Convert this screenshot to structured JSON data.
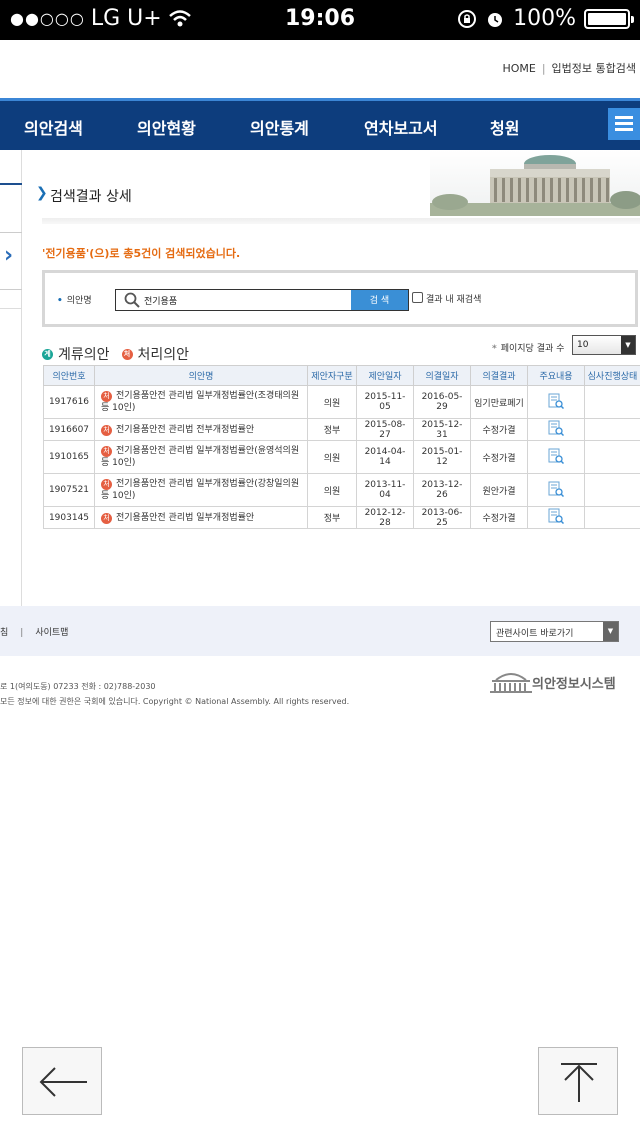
{
  "status": {
    "signal": "●●○○○",
    "carrier": "LG U+",
    "time": "19:06",
    "battery": "100%"
  },
  "toplinks": {
    "home": "HOME",
    "sep": "|",
    "integrated": "입법정보 통합검색"
  },
  "nav": {
    "items": [
      "의안검색",
      "의안현황",
      "의안통계",
      "연차보고서",
      "청원"
    ]
  },
  "breadcrumb": {
    "title": "검색결과 상세"
  },
  "result_message": "'전기용품'(으)로 총5건이 검색되었습니다.",
  "search": {
    "label": "의안명",
    "value": "전기용품",
    "button": "검 색",
    "within_label": "결과 내 재검색"
  },
  "legend": {
    "pending_badge": "계",
    "pending": "계류의안",
    "processed_badge": "처",
    "processed": "처리의안"
  },
  "perpage": {
    "label": "페이지당 결과 수",
    "value": "10"
  },
  "table": {
    "headers": [
      "의안번호",
      "의안명",
      "제안자구분",
      "제안일자",
      "의결일자",
      "의결결과",
      "주요내용",
      "심사진행상태"
    ],
    "rows": [
      {
        "no": "1917616",
        "badge": "처",
        "name": "전기용품안전 관리법 일부개정법률안(조경태의원 등 10인)",
        "proposer": "의원",
        "proposed": "2015-11-05",
        "decided": "2016-05-29",
        "result": "임기만료폐기"
      },
      {
        "no": "1916607",
        "badge": "처",
        "name": "전기용품안전 관리법 전부개정법률안",
        "proposer": "정부",
        "proposed": "2015-08-27",
        "decided": "2015-12-31",
        "result": "수정가결"
      },
      {
        "no": "1910165",
        "badge": "처",
        "name": "전기용품안전 관리법 일부개정법률안(윤영석의원 등 10인)",
        "proposer": "의원",
        "proposed": "2014-04-14",
        "decided": "2015-01-12",
        "result": "수정가결"
      },
      {
        "no": "1907521",
        "badge": "처",
        "name": "전기용품안전 관리법 일부개정법률안(강창일의원 등 10인)",
        "proposer": "의원",
        "proposed": "2013-11-04",
        "decided": "2013-12-26",
        "result": "원안가결"
      },
      {
        "no": "1903145",
        "badge": "처",
        "name": "전기용품안전 관리법 일부개정법률안",
        "proposer": "정부",
        "proposed": "2012-12-28",
        "decided": "2013-06-25",
        "result": "수정가결"
      }
    ]
  },
  "footer": {
    "link1": "침",
    "sep": "|",
    "link2": "사이트맵",
    "related": "관련사이트 바로가기",
    "address": "로 1(여의도동) 07233   전화 : 02)788-2030",
    "copyright": "모든 정보에 대한 권한은 국회에 있습니다. Copyright © National Assembly. All rights reserved.",
    "logo_text": "의안정보시스템"
  },
  "colors": {
    "nav_bg": "#0d3d7d",
    "accent": "#3a8fd6",
    "message": "#e56b12",
    "processed_badge": "#e55f42",
    "pending_badge": "#1aa597"
  }
}
